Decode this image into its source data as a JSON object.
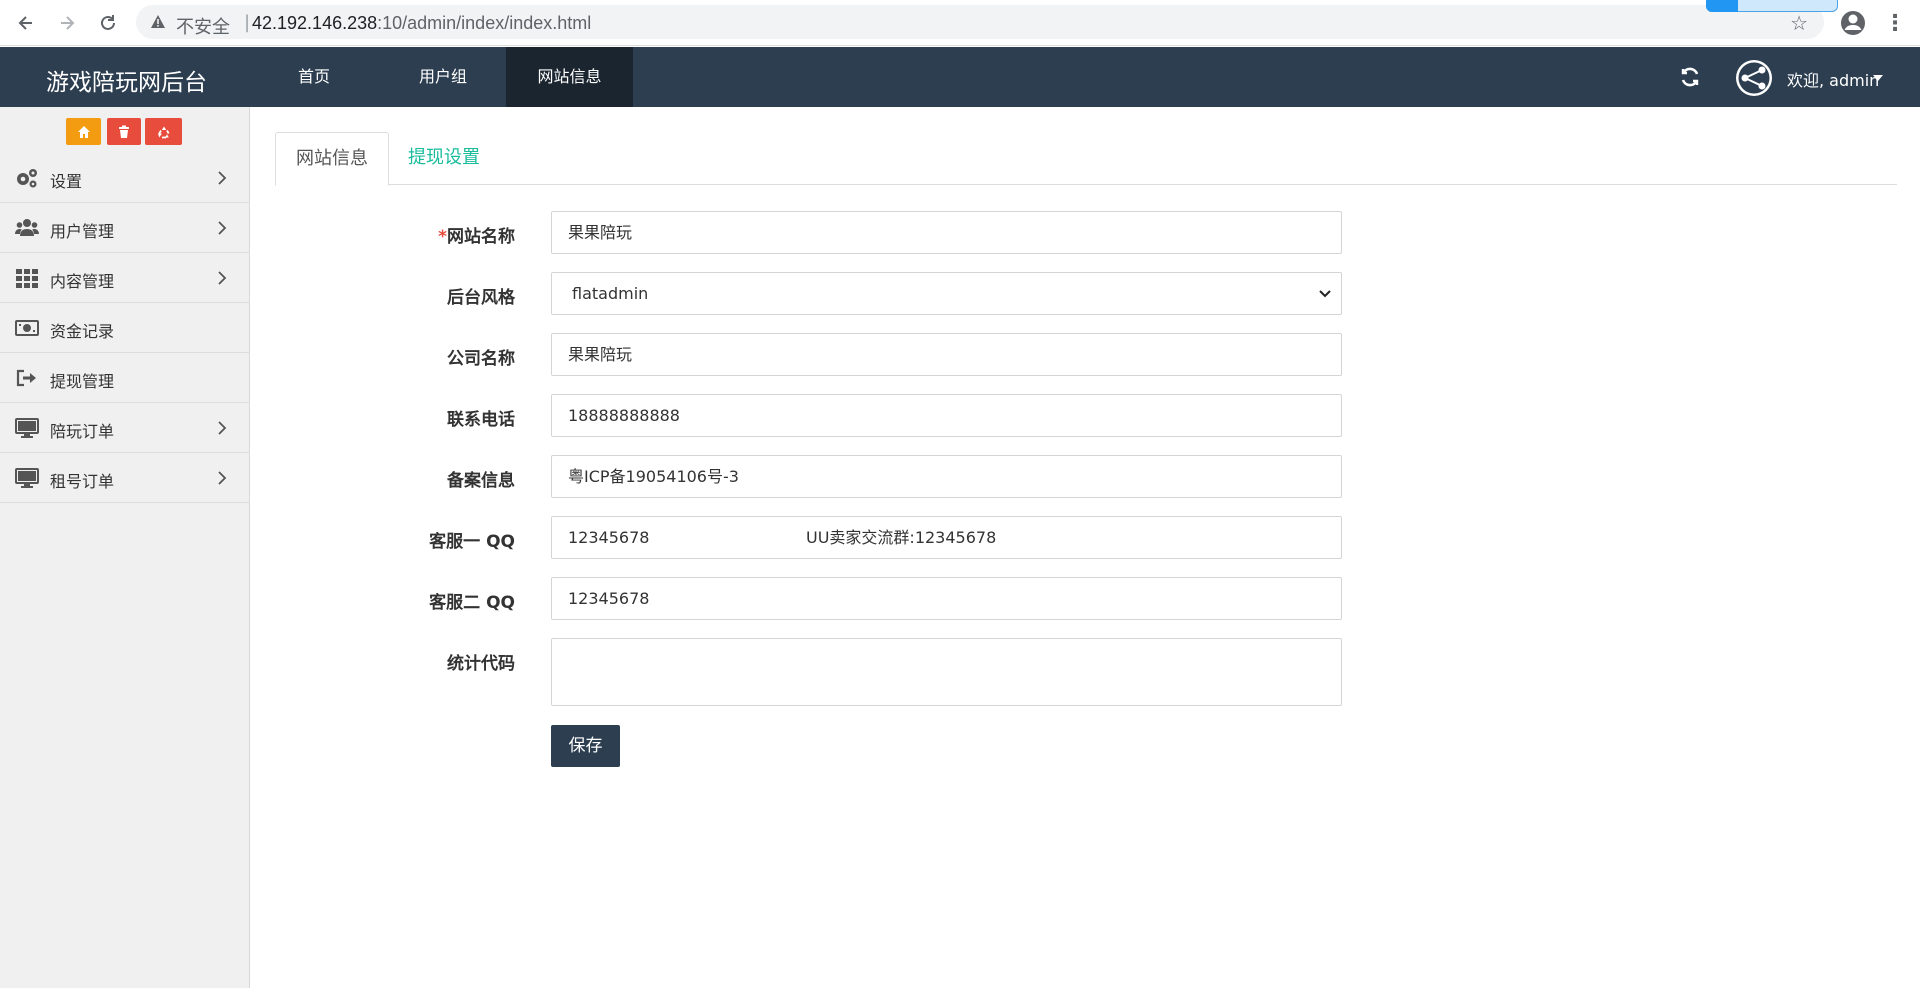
{
  "browser": {
    "insecure_label": "不安全",
    "separator": "|",
    "url_host": "42.192.146.238",
    "url_path": ":10/admin/index/index.html"
  },
  "topnav": {
    "brand": "游戏陪玩网后台",
    "items": [
      {
        "label": "首页",
        "active": false
      },
      {
        "label": "用户组",
        "active": false
      },
      {
        "label": "网站信息",
        "active": true
      }
    ],
    "welcome": "欢迎, admin"
  },
  "sidebar": {
    "items": [
      {
        "label": "设置",
        "icon": "gears-icon",
        "has_children": true
      },
      {
        "label": "用户管理",
        "icon": "users-icon",
        "has_children": true
      },
      {
        "label": "内容管理",
        "icon": "grid-icon",
        "has_children": true
      },
      {
        "label": "资金记录",
        "icon": "money-icon",
        "has_children": false
      },
      {
        "label": "提现管理",
        "icon": "sign-out-icon",
        "has_children": false
      },
      {
        "label": "陪玩订单",
        "icon": "monitor-icon",
        "has_children": true
      },
      {
        "label": "租号订单",
        "icon": "monitor-icon",
        "has_children": true
      }
    ]
  },
  "tabs": [
    {
      "label": "网站信息",
      "active": true
    },
    {
      "label": "提现设置",
      "active": false
    }
  ],
  "form": {
    "site_name": {
      "required_mark": "*",
      "label": "网站名称",
      "value": "果果陪玩"
    },
    "admin_theme": {
      "label": "后台风格",
      "value": "flatadmin"
    },
    "company_name": {
      "label": "公司名称",
      "value": "果果陪玩"
    },
    "phone": {
      "label": "联系电话",
      "value": "18888888888"
    },
    "icp": {
      "label": "备案信息",
      "value": "粤ICP备19054106号-3"
    },
    "qq1": {
      "label": "客服一 QQ",
      "value": "12345678",
      "extra": "UU卖家交流群:12345678"
    },
    "qq2": {
      "label": "客服二 QQ",
      "value": "12345678"
    },
    "stats_code": {
      "label": "统计代码",
      "value": ""
    },
    "save_label": "保存"
  },
  "colors": {
    "nav_bg": "#2c3e50",
    "nav_active": "#1a252f",
    "accent": "#1abc9c",
    "btn_orange": "#f39c12",
    "btn_red": "#e74c3c"
  }
}
